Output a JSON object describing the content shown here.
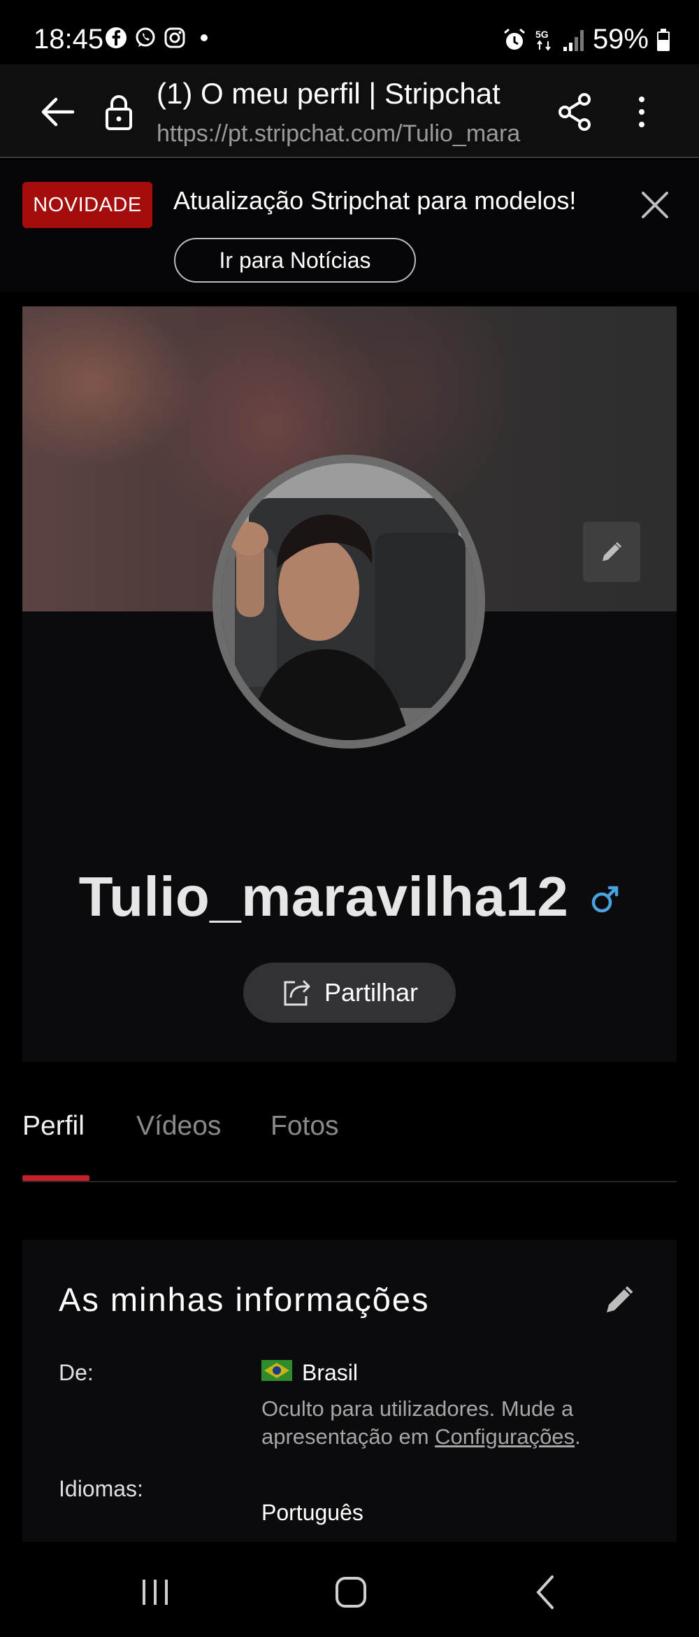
{
  "status_bar": {
    "time": "18:45",
    "app_icons": [
      "facebook-icon",
      "whatsapp-icon",
      "instagram-icon",
      "dot-icon"
    ],
    "network": "5G",
    "battery": "59%"
  },
  "browser": {
    "title": "(1) O meu perfil | Stripchat",
    "url": "https://pt.stripchat.com/Tulio_mara"
  },
  "news": {
    "badge": "NOVIDADE",
    "text": "Atualização Stripchat para modelos!",
    "button": "Ir para Notícias"
  },
  "profile": {
    "username": "Tulio_maravilha12",
    "gender_symbol": "♂",
    "share_label": "Partilhar"
  },
  "tabs": [
    {
      "label": "Perfil",
      "active": true
    },
    {
      "label": "Vídeos",
      "active": false
    },
    {
      "label": "Fotos",
      "active": false
    }
  ],
  "info": {
    "title": "As minhas informações",
    "from_label": "De:",
    "country": "Brasil",
    "note_prefix": "Oculto para utilizadores. Mude a apresentação em ",
    "note_link": "Configurações",
    "note_suffix": ".",
    "languages_label": "Idiomas:",
    "languages": "Português"
  },
  "colors": {
    "accent": "#c8202a",
    "badge": "#a50d0d",
    "gender": "#4aa3e0"
  }
}
